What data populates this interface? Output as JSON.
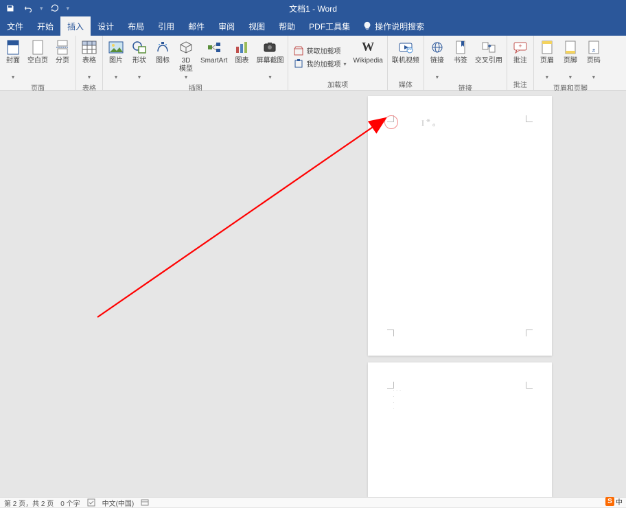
{
  "title": "文档1 - Word",
  "qat": {
    "save": "保存",
    "undo": "撤销",
    "redo": "恢复"
  },
  "menus": [
    "文件",
    "开始",
    "插入",
    "设计",
    "布局",
    "引用",
    "邮件",
    "审阅",
    "视图",
    "帮助",
    "PDF工具集"
  ],
  "active_menu_index": 2,
  "tell_me": "操作说明搜索",
  "ribbon_groups": [
    {
      "label": "页面",
      "items": [
        {
          "name": "cover-page",
          "label": "封面",
          "dd": true
        },
        {
          "name": "blank-page",
          "label": "空白页"
        },
        {
          "name": "page-break",
          "label": "分页"
        }
      ]
    },
    {
      "label": "表格",
      "items": [
        {
          "name": "table",
          "label": "表格",
          "dd": true
        }
      ]
    },
    {
      "label": "插图",
      "items": [
        {
          "name": "picture",
          "label": "图片",
          "dd": true
        },
        {
          "name": "shapes",
          "label": "形状",
          "dd": true
        },
        {
          "name": "icons",
          "label": "图标"
        },
        {
          "name": "3d-models",
          "label": "3D\n模型",
          "dd": true
        },
        {
          "name": "smartart",
          "label": "SmartArt"
        },
        {
          "name": "chart",
          "label": "图表"
        },
        {
          "name": "screenshot",
          "label": "屏幕截图",
          "dd": true
        }
      ]
    },
    {
      "label": "加载项",
      "items_stack": [
        {
          "name": "get-addins",
          "label": "获取加载项"
        },
        {
          "name": "my-addins",
          "label": "我的加载项",
          "dd": true
        }
      ],
      "tail": {
        "name": "wikipedia",
        "label": "Wikipedia"
      }
    },
    {
      "label": "媒体",
      "items": [
        {
          "name": "online-video",
          "label": "联机视频"
        }
      ]
    },
    {
      "label": "链接",
      "items": [
        {
          "name": "link",
          "label": "链接",
          "dd": true
        },
        {
          "name": "bookmark",
          "label": "书签"
        },
        {
          "name": "cross-ref",
          "label": "交叉引用"
        }
      ]
    },
    {
      "label": "批注",
      "items": [
        {
          "name": "comment",
          "label": "批注"
        }
      ]
    },
    {
      "label": "页眉和页脚",
      "items": [
        {
          "name": "header",
          "label": "页眉",
          "dd": true
        },
        {
          "name": "footer",
          "label": "页脚",
          "dd": true
        },
        {
          "name": "page-number",
          "label": "页码",
          "dd": true
        }
      ]
    }
  ],
  "status": {
    "page": "第 2 页，共 2 页",
    "words": "0 个字",
    "spell": "",
    "lang": "中文(中国)",
    "ime_cn": "中"
  }
}
